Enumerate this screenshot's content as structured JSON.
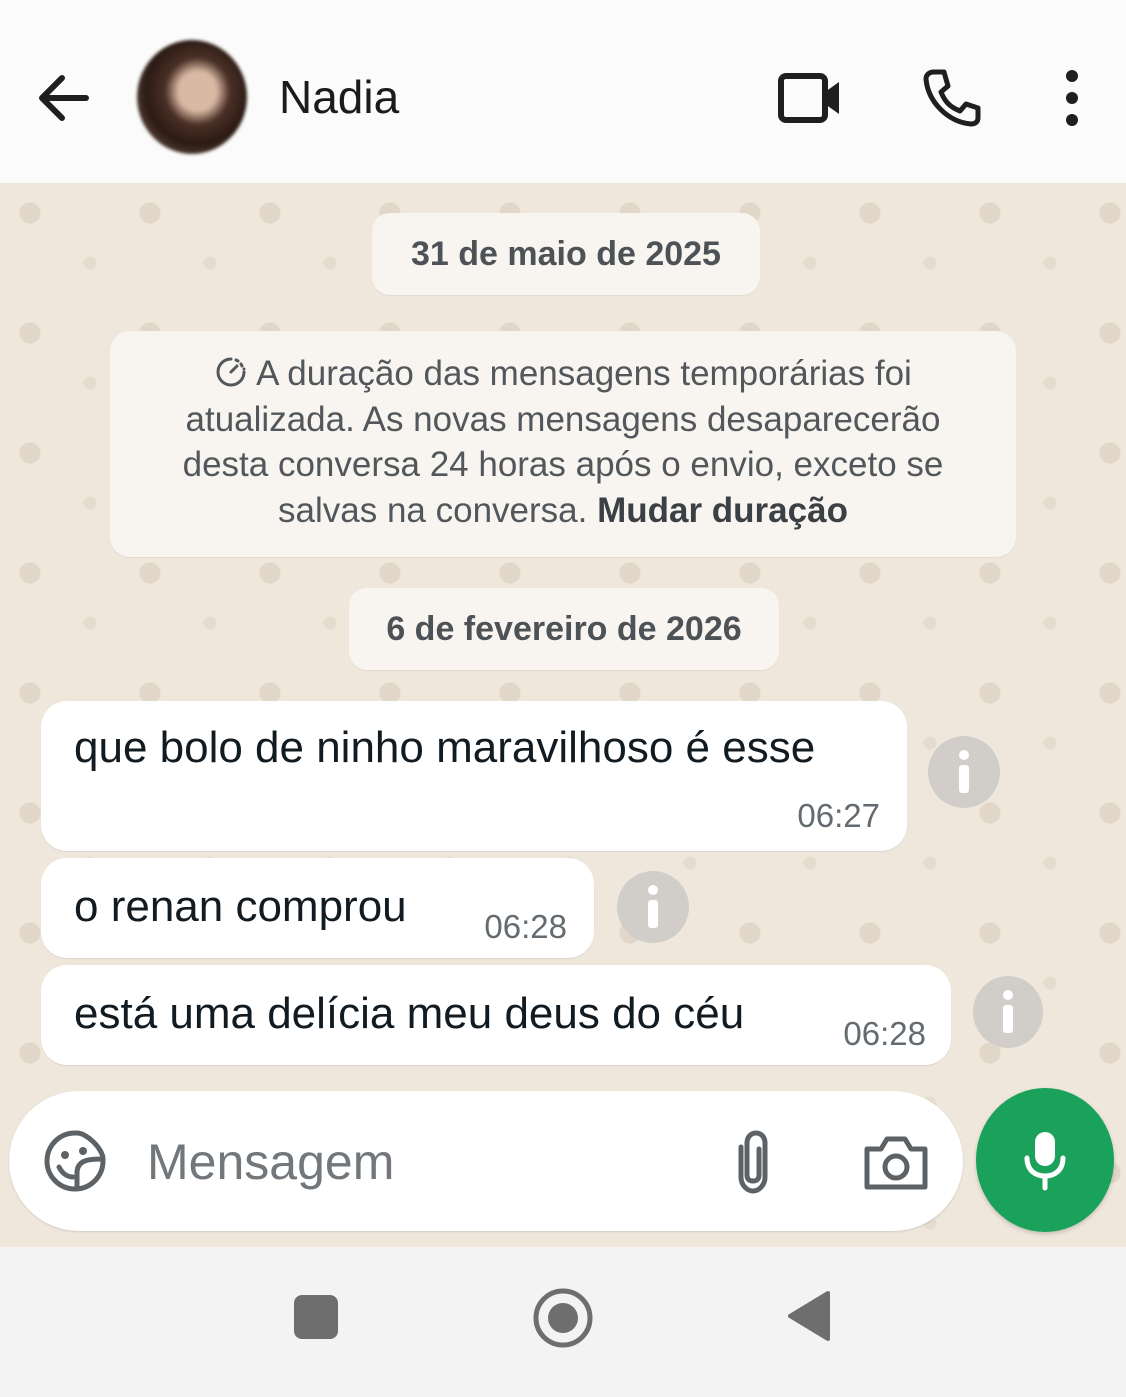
{
  "header": {
    "contact_name": "Nadia",
    "back_icon": "arrow-left-icon",
    "video_icon": "video-camera-icon",
    "call_icon": "phone-icon",
    "more_icon": "more-vertical-icon"
  },
  "chat": {
    "date_1": "31 de maio de 2025",
    "system_note": {
      "text": "A duração das mensagens temporárias foi atualizada. As novas mensagens desaparecerão desta conversa 24 horas após o envio, exceto se salvas na conversa.",
      "link": "Mudar duração",
      "icon": "disappearing-timer-icon"
    },
    "date_2": "6 de fevereiro de 2026",
    "messages": [
      {
        "text": "que bolo de ninho maravilhoso é esse",
        "time": "06:27"
      },
      {
        "text": "o renan comprou",
        "time": "06:28"
      },
      {
        "text": "está uma delícia meu deus do céu",
        "time": "06:28"
      }
    ]
  },
  "composer": {
    "placeholder": "Mensagem",
    "sticker_icon": "sticker-icon",
    "attach_icon": "paperclip-icon",
    "camera_icon": "camera-icon",
    "mic_icon": "microphone-icon"
  },
  "colors": {
    "accent_green": "#1aa15a",
    "chat_background": "#efe7dc",
    "bubble": "#ffffff"
  }
}
